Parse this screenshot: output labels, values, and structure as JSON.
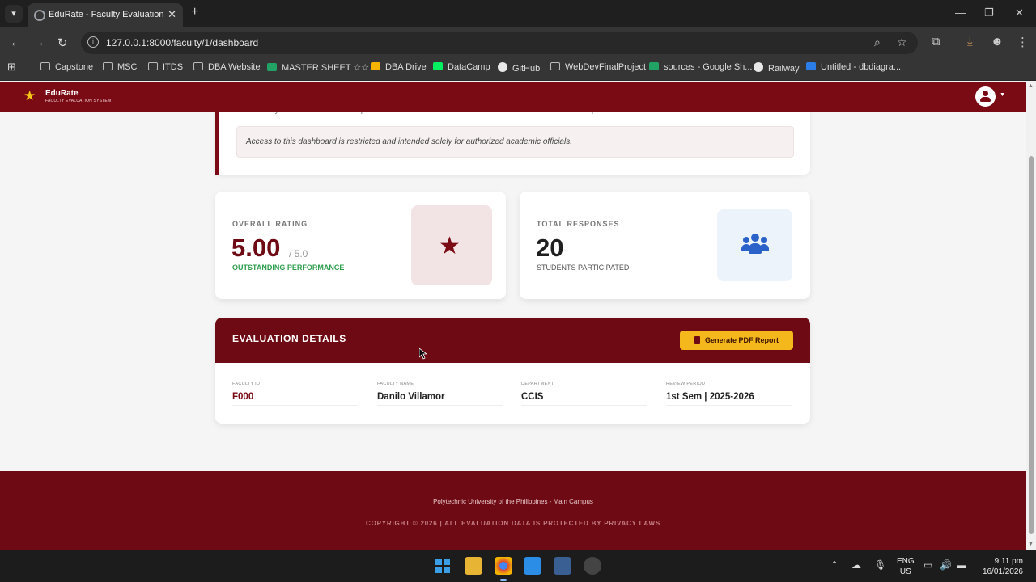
{
  "browser": {
    "tab_title": "EduRate - Faculty Evaluation Sy",
    "url": "127.0.0.1:8000/faculty/1/dashboard",
    "bookmarks": [
      {
        "label": "Capstone",
        "icon": "folder-icon"
      },
      {
        "label": "MSC",
        "icon": "folder-icon"
      },
      {
        "label": "ITDS",
        "icon": "folder-icon"
      },
      {
        "label": "DBA Website",
        "icon": "folder-icon"
      },
      {
        "label": "MASTER SHEET ☆☆..",
        "icon": "sheets-icon"
      },
      {
        "label": "DBA Drive",
        "icon": "drive-icon"
      },
      {
        "label": "DataCamp",
        "icon": "datacamp-icon"
      },
      {
        "label": "GitHub",
        "icon": "github-icon"
      },
      {
        "label": "WebDevFinalProject",
        "icon": "folder-icon"
      },
      {
        "label": "sources - Google Sh...",
        "icon": "sheets-icon"
      },
      {
        "label": "Railway",
        "icon": "railway-icon"
      },
      {
        "label": "Untitled - dbdiagra...",
        "icon": "dbdiagram-icon"
      }
    ]
  },
  "header": {
    "brand": "EduRate",
    "brand_sub": "FACULTY EVALUATION SYSTEM"
  },
  "intro": {
    "text": "This faculty evaluation dashboard provides an overview of evaluation results for the current review period.",
    "notice": "Access to this dashboard is restricted and intended solely for authorized academic officials."
  },
  "rating_card": {
    "label": "OVERALL RATING",
    "value": "5.00",
    "suffix": "/ 5.0",
    "note": "OUTSTANDING PERFORMANCE",
    "accent": "#2e9d4e"
  },
  "responses_card": {
    "label": "TOTAL RESPONSES",
    "value": "20",
    "note": "STUDENTS PARTICIPATED"
  },
  "details": {
    "title": "EVALUATION DETAILS",
    "button": "Generate PDF Report",
    "fields": [
      {
        "label": "FACULTY ID",
        "value": "F000"
      },
      {
        "label": "FACULTY NAME",
        "value": "Danilo Villamor"
      },
      {
        "label": "DEPARTMENT",
        "value": "CCIS"
      },
      {
        "label": "REVIEW PERIOD",
        "value": "1st Sem | 2025-2026"
      }
    ]
  },
  "footer": {
    "campus": "Polytechnic University of the Philippines - Main Campus",
    "copyright": "COPYRIGHT © 2026 | ALL EVALUATION DATA IS PROTECTED BY PRIVACY LAWS"
  },
  "taskbar": {
    "lang_1": "ENG",
    "lang_2": "US",
    "time": "9:11 pm",
    "date": "16/01/2026"
  },
  "colors": {
    "brand_maroon": "#7a0a14",
    "accent_yellow": "#f5b81c",
    "success_green": "#2e9d4e",
    "icon_blue": "#2a62c9"
  }
}
